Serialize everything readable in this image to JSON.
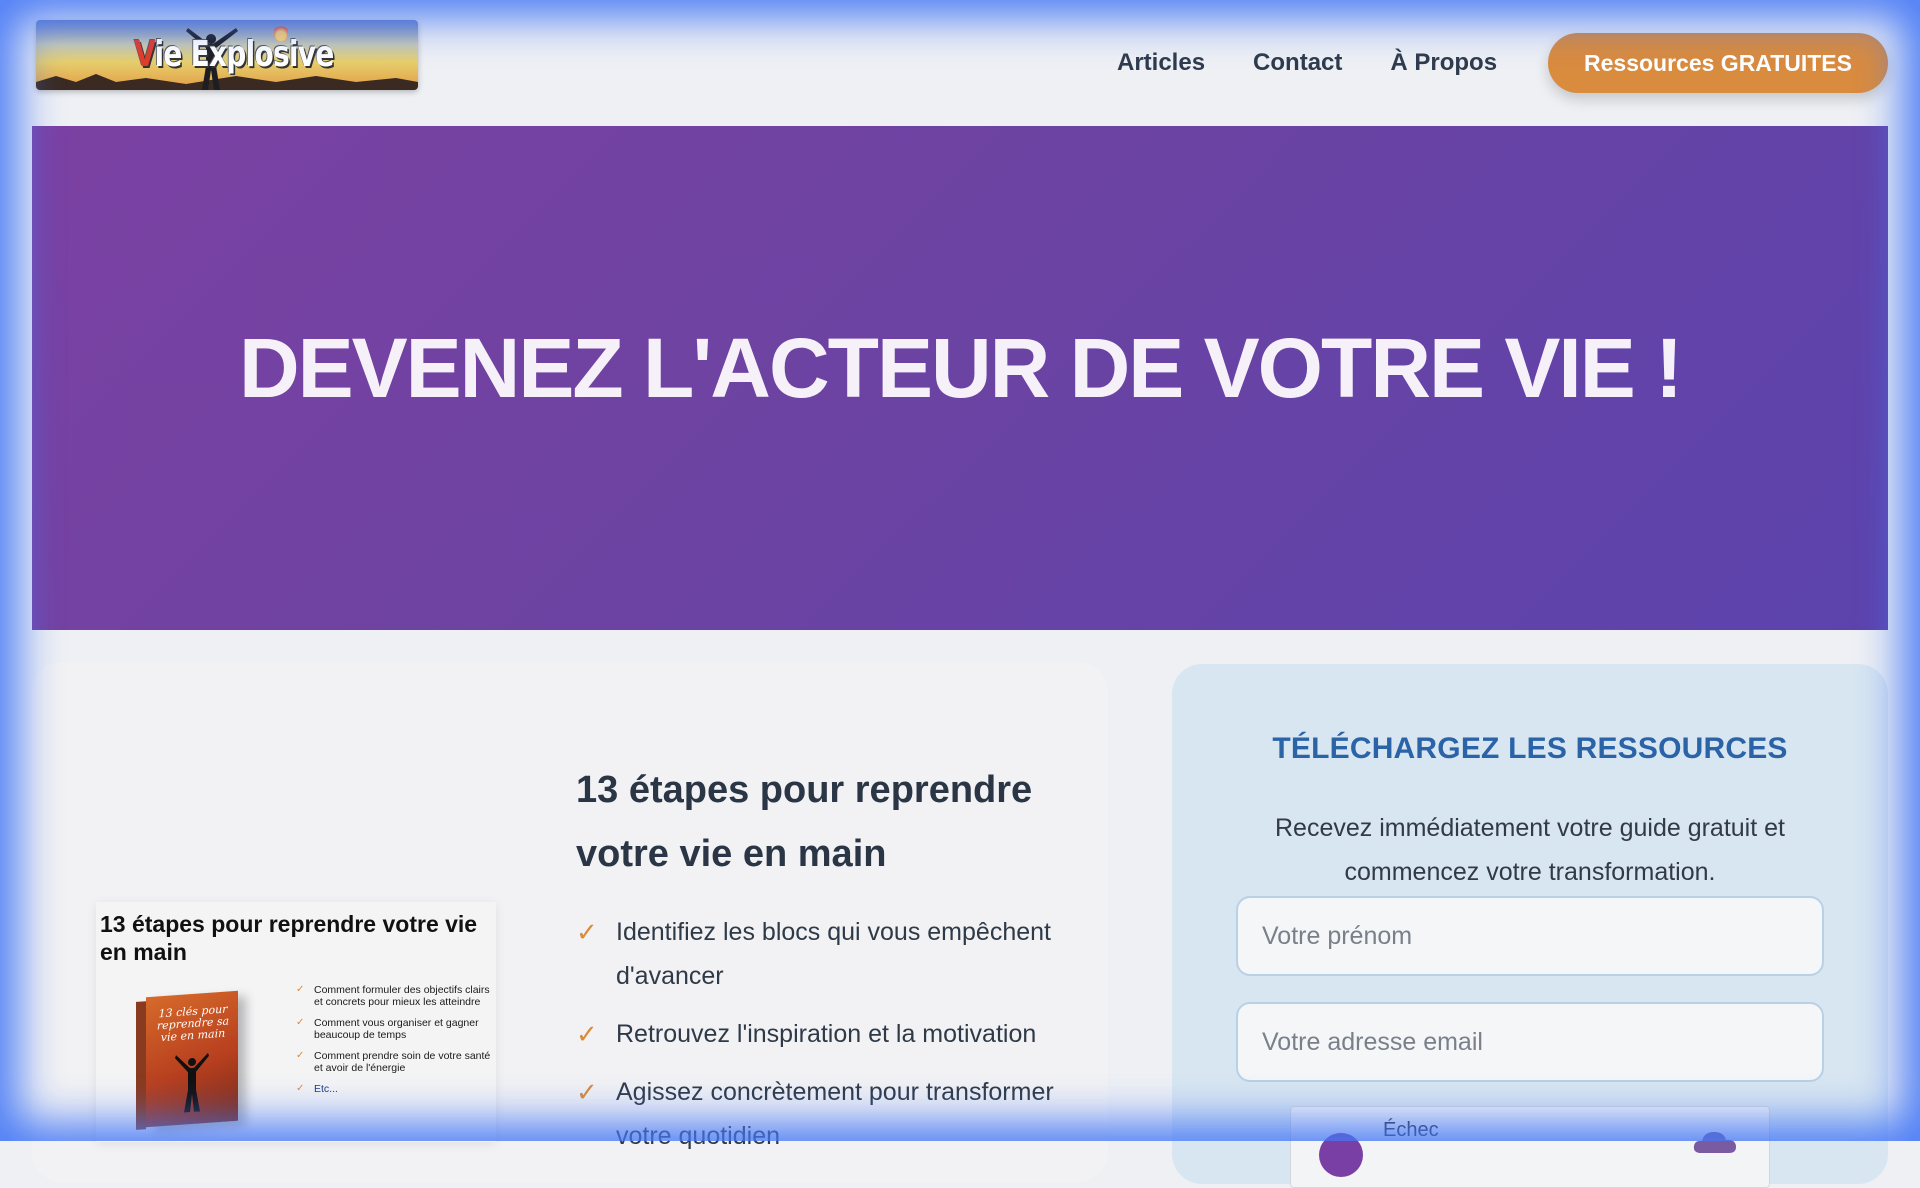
{
  "header": {
    "logo_text_first": "V",
    "logo_text_rest": "ie Explosive",
    "nav": [
      "Articles",
      "Contact",
      "À Propos"
    ],
    "cta_label": "Ressources GRATUITES"
  },
  "hero": {
    "title": "DEVENEZ L'ACTEUR DE VOTRE VIE !"
  },
  "guide": {
    "book_title": "13 étapes pour reprendre votre vie en main",
    "cover_text": "13 clés pour reprendre sa vie en main",
    "book_points": [
      "Comment formuler des objectifs clairs et concrets pour mieux les atteindre",
      "Comment vous organiser et gagner beaucoup de temps",
      "Comment prendre soin de votre santé et avoir de l'énergie",
      "Etc..."
    ],
    "title": "13 étapes pour reprendre votre vie en main",
    "benefits": [
      "Identifiez les blocs qui vous empêchent d'avancer",
      "Retrouvez l'inspiration et la motivation",
      "Agissez concrètement pour transformer votre quotidien"
    ]
  },
  "form": {
    "heading": "TÉLÉCHARGEZ LES RESSOURCES",
    "description": "Recevez immédiatement votre guide gratuit et commencez votre transformation.",
    "firstname_placeholder": "Votre prénom",
    "email_placeholder": "Votre adresse email",
    "captcha_status": "Échec"
  },
  "colors": {
    "accent_orange": "#d98b3e",
    "hero_purple": "#6c43a2",
    "heading_blue": "#2b63a8",
    "frame_blue": "#4678f5"
  }
}
